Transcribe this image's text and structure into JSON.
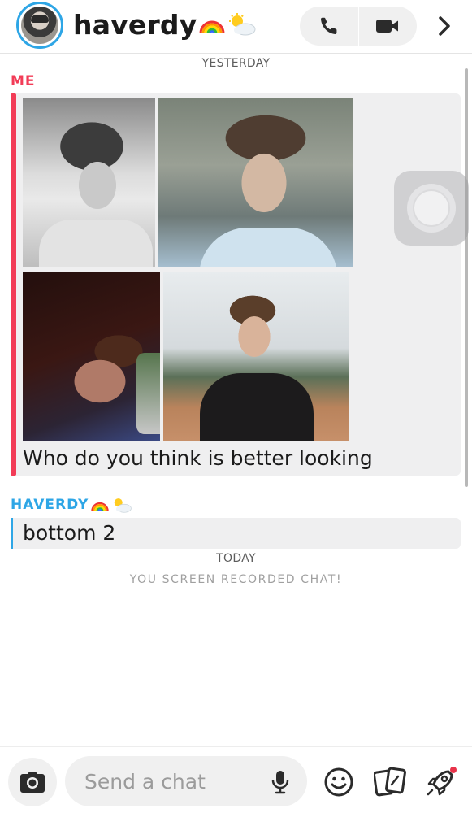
{
  "header": {
    "contact_name": "haverdy",
    "contact_emoji": [
      "rainbow-emoji",
      "sun-behind-cloud-emoji"
    ],
    "call_icon": "phone-icon",
    "video_icon": "video-camera-icon",
    "more_icon": "chevron-right-icon"
  },
  "chat": {
    "day_yesterday": "YESTERDAY",
    "me_label": "ME",
    "me_message": "Who do you think is better looking",
    "them_label": "HAVERDY",
    "them_message": "bottom 2",
    "day_today": "TODAY",
    "system_notice": "YOU SCREEN RECORDED CHAT!"
  },
  "composer": {
    "placeholder": "Send a chat",
    "camera_icon": "camera-icon",
    "mic_icon": "microphone-icon",
    "emoji_icon": "smiley-icon",
    "stickers_icon": "cards-icon",
    "rocket_icon": "rocket-icon"
  },
  "colors": {
    "me_accent": "#f23c57",
    "them_accent": "#2ea6e6",
    "bubble_bg": "#efeff0",
    "notification_dot": "#e8334a"
  }
}
